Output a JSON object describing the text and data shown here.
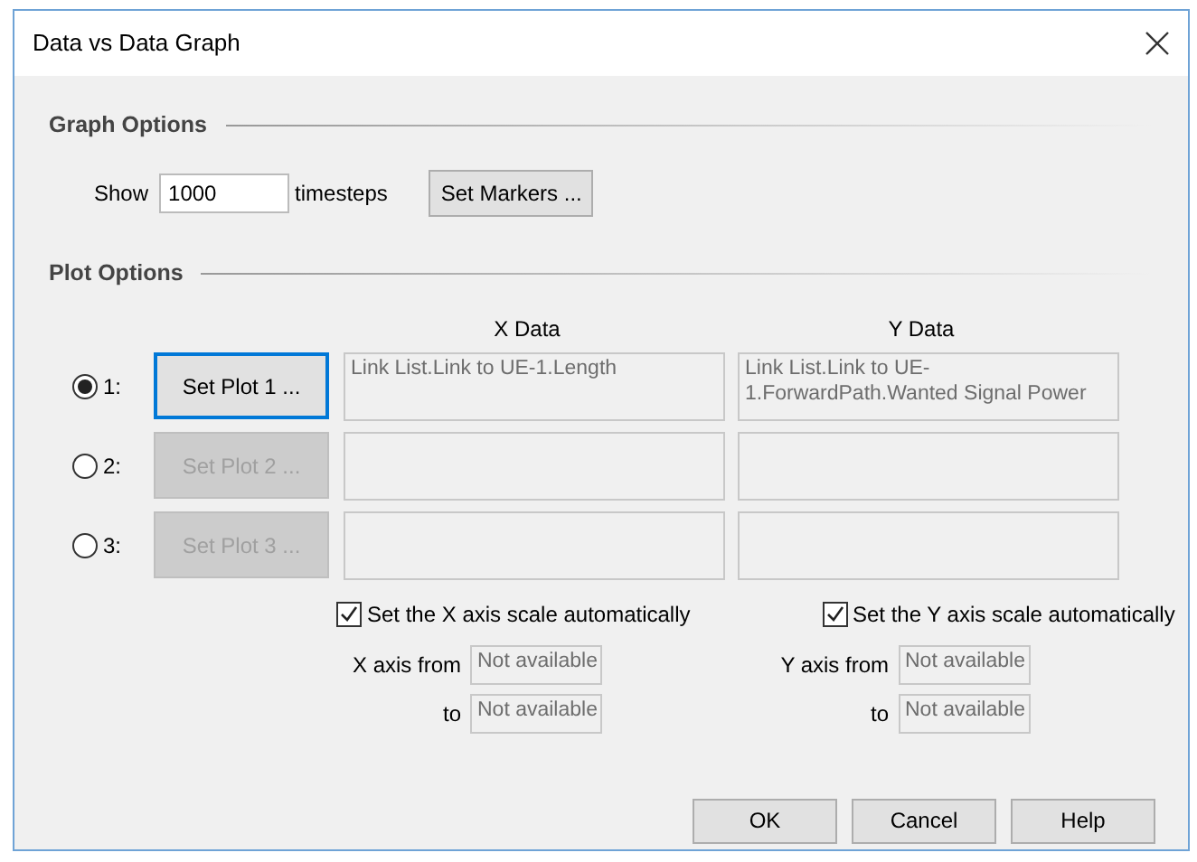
{
  "window": {
    "title": "Data vs Data Graph"
  },
  "graph_options": {
    "heading": "Graph Options",
    "show_label": "Show",
    "timesteps_value": "1000",
    "unit_label": "timesteps",
    "markers_button": "Set Markers ..."
  },
  "plot_options": {
    "heading": "Plot Options",
    "x_header": "X Data",
    "y_header": "Y Data",
    "plots": [
      {
        "label": "1:",
        "selected": true,
        "button": "Set Plot 1 ...",
        "disabled": false,
        "focused": true,
        "x_data": "Link List.Link to UE-1.Length",
        "y_data": "Link List.Link to UE-1.ForwardPath.Wanted Signal Power"
      },
      {
        "label": "2:",
        "selected": false,
        "button": "Set Plot 2 ...",
        "disabled": true,
        "focused": false
      },
      {
        "label": "3:",
        "selected": false,
        "button": "Set Plot 3 ...",
        "disabled": true,
        "focused": false
      }
    ]
  },
  "axes": [
    {
      "auto_label": "Set the X axis scale automatically",
      "checked": true,
      "from_label": "X axis from",
      "from_value": "Not available",
      "to_label": "to",
      "to_value": "Not available"
    },
    {
      "auto_label": "Set the Y axis scale automatically",
      "checked": true,
      "from_label": "Y axis from",
      "from_value": "Not available",
      "to_label": "to",
      "to_value": "Not available"
    }
  ],
  "buttons": [
    "OK",
    "Cancel",
    "Help"
  ]
}
